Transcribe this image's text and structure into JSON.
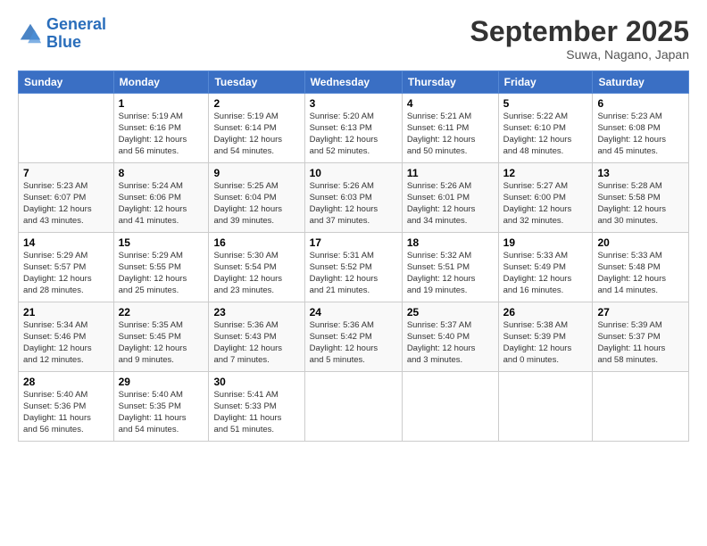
{
  "header": {
    "logo_line1": "General",
    "logo_line2": "Blue",
    "month": "September 2025",
    "location": "Suwa, Nagano, Japan"
  },
  "days_of_week": [
    "Sunday",
    "Monday",
    "Tuesday",
    "Wednesday",
    "Thursday",
    "Friday",
    "Saturday"
  ],
  "weeks": [
    [
      {
        "num": "",
        "info": ""
      },
      {
        "num": "1",
        "info": "Sunrise: 5:19 AM\nSunset: 6:16 PM\nDaylight: 12 hours\nand 56 minutes."
      },
      {
        "num": "2",
        "info": "Sunrise: 5:19 AM\nSunset: 6:14 PM\nDaylight: 12 hours\nand 54 minutes."
      },
      {
        "num": "3",
        "info": "Sunrise: 5:20 AM\nSunset: 6:13 PM\nDaylight: 12 hours\nand 52 minutes."
      },
      {
        "num": "4",
        "info": "Sunrise: 5:21 AM\nSunset: 6:11 PM\nDaylight: 12 hours\nand 50 minutes."
      },
      {
        "num": "5",
        "info": "Sunrise: 5:22 AM\nSunset: 6:10 PM\nDaylight: 12 hours\nand 48 minutes."
      },
      {
        "num": "6",
        "info": "Sunrise: 5:23 AM\nSunset: 6:08 PM\nDaylight: 12 hours\nand 45 minutes."
      }
    ],
    [
      {
        "num": "7",
        "info": "Sunrise: 5:23 AM\nSunset: 6:07 PM\nDaylight: 12 hours\nand 43 minutes."
      },
      {
        "num": "8",
        "info": "Sunrise: 5:24 AM\nSunset: 6:06 PM\nDaylight: 12 hours\nand 41 minutes."
      },
      {
        "num": "9",
        "info": "Sunrise: 5:25 AM\nSunset: 6:04 PM\nDaylight: 12 hours\nand 39 minutes."
      },
      {
        "num": "10",
        "info": "Sunrise: 5:26 AM\nSunset: 6:03 PM\nDaylight: 12 hours\nand 37 minutes."
      },
      {
        "num": "11",
        "info": "Sunrise: 5:26 AM\nSunset: 6:01 PM\nDaylight: 12 hours\nand 34 minutes."
      },
      {
        "num": "12",
        "info": "Sunrise: 5:27 AM\nSunset: 6:00 PM\nDaylight: 12 hours\nand 32 minutes."
      },
      {
        "num": "13",
        "info": "Sunrise: 5:28 AM\nSunset: 5:58 PM\nDaylight: 12 hours\nand 30 minutes."
      }
    ],
    [
      {
        "num": "14",
        "info": "Sunrise: 5:29 AM\nSunset: 5:57 PM\nDaylight: 12 hours\nand 28 minutes."
      },
      {
        "num": "15",
        "info": "Sunrise: 5:29 AM\nSunset: 5:55 PM\nDaylight: 12 hours\nand 25 minutes."
      },
      {
        "num": "16",
        "info": "Sunrise: 5:30 AM\nSunset: 5:54 PM\nDaylight: 12 hours\nand 23 minutes."
      },
      {
        "num": "17",
        "info": "Sunrise: 5:31 AM\nSunset: 5:52 PM\nDaylight: 12 hours\nand 21 minutes."
      },
      {
        "num": "18",
        "info": "Sunrise: 5:32 AM\nSunset: 5:51 PM\nDaylight: 12 hours\nand 19 minutes."
      },
      {
        "num": "19",
        "info": "Sunrise: 5:33 AM\nSunset: 5:49 PM\nDaylight: 12 hours\nand 16 minutes."
      },
      {
        "num": "20",
        "info": "Sunrise: 5:33 AM\nSunset: 5:48 PM\nDaylight: 12 hours\nand 14 minutes."
      }
    ],
    [
      {
        "num": "21",
        "info": "Sunrise: 5:34 AM\nSunset: 5:46 PM\nDaylight: 12 hours\nand 12 minutes."
      },
      {
        "num": "22",
        "info": "Sunrise: 5:35 AM\nSunset: 5:45 PM\nDaylight: 12 hours\nand 9 minutes."
      },
      {
        "num": "23",
        "info": "Sunrise: 5:36 AM\nSunset: 5:43 PM\nDaylight: 12 hours\nand 7 minutes."
      },
      {
        "num": "24",
        "info": "Sunrise: 5:36 AM\nSunset: 5:42 PM\nDaylight: 12 hours\nand 5 minutes."
      },
      {
        "num": "25",
        "info": "Sunrise: 5:37 AM\nSunset: 5:40 PM\nDaylight: 12 hours\nand 3 minutes."
      },
      {
        "num": "26",
        "info": "Sunrise: 5:38 AM\nSunset: 5:39 PM\nDaylight: 12 hours\nand 0 minutes."
      },
      {
        "num": "27",
        "info": "Sunrise: 5:39 AM\nSunset: 5:37 PM\nDaylight: 11 hours\nand 58 minutes."
      }
    ],
    [
      {
        "num": "28",
        "info": "Sunrise: 5:40 AM\nSunset: 5:36 PM\nDaylight: 11 hours\nand 56 minutes."
      },
      {
        "num": "29",
        "info": "Sunrise: 5:40 AM\nSunset: 5:35 PM\nDaylight: 11 hours\nand 54 minutes."
      },
      {
        "num": "30",
        "info": "Sunrise: 5:41 AM\nSunset: 5:33 PM\nDaylight: 11 hours\nand 51 minutes."
      },
      {
        "num": "",
        "info": ""
      },
      {
        "num": "",
        "info": ""
      },
      {
        "num": "",
        "info": ""
      },
      {
        "num": "",
        "info": ""
      }
    ]
  ]
}
